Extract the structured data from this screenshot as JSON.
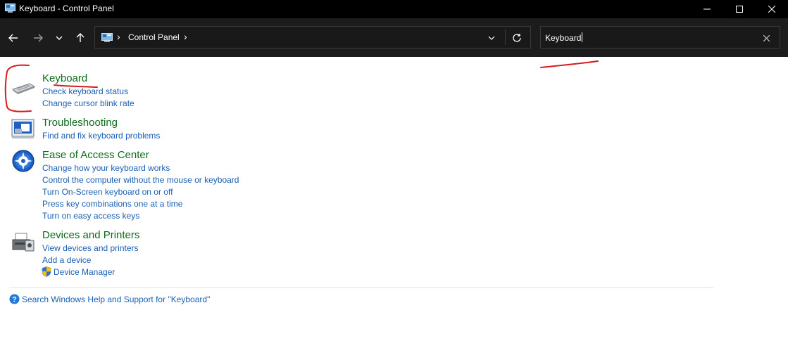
{
  "window": {
    "title": "Keyboard - Control Panel"
  },
  "address_bar": {
    "breadcrumb": [
      "Control Panel"
    ]
  },
  "search": {
    "value": "Keyboard"
  },
  "results": [
    {
      "heading": "Keyboard",
      "icon": "keyboard-icon",
      "links": [
        "Check keyboard status",
        "Change cursor blink rate"
      ]
    },
    {
      "heading": "Troubleshooting",
      "icon": "troubleshooting-icon",
      "links": [
        "Find and fix keyboard problems"
      ]
    },
    {
      "heading": "Ease of Access Center",
      "icon": "ease-of-access-icon",
      "links": [
        "Change how your keyboard works",
        "Control the computer without the mouse or keyboard",
        "Turn On-Screen keyboard on or off",
        "Press key combinations one at a time",
        "Turn on easy access keys"
      ]
    },
    {
      "heading": "Devices and Printers",
      "icon": "printer-icon",
      "links": [
        "View devices and printers",
        "Add a device",
        "Device Manager"
      ]
    }
  ],
  "help": {
    "label": "Search Windows Help and Support for \"Keyboard\""
  },
  "colors": {
    "heading": "#0d6b1c",
    "link": "#1a5fb4",
    "annotation": "#d81b1b"
  }
}
